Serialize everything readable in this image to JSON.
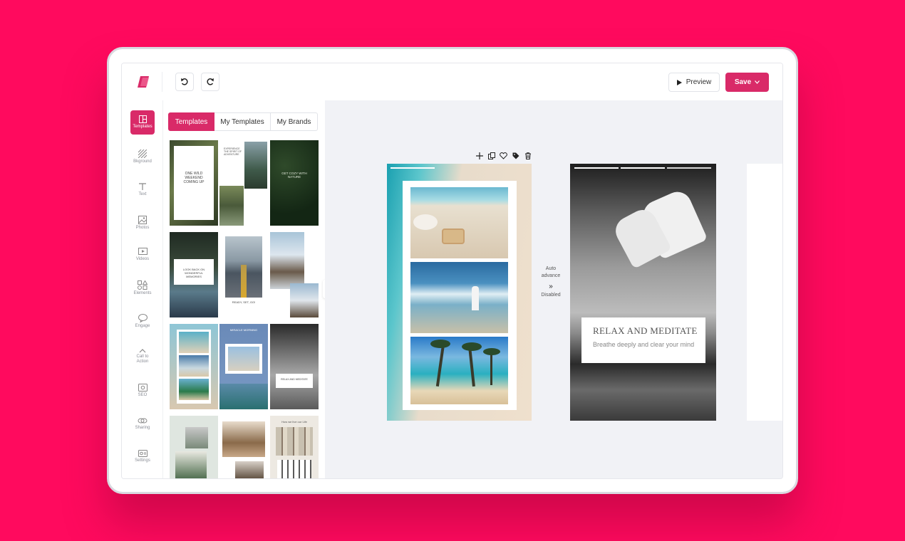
{
  "toolbar": {
    "undo_icon": "undo-icon",
    "redo_icon": "redo-icon",
    "preview_label": "Preview",
    "save_label": "Save"
  },
  "rail": [
    {
      "label": "Templates",
      "icon": "templates-icon",
      "active": true
    },
    {
      "label": "Bkground",
      "icon": "background-icon"
    },
    {
      "label": "Text",
      "icon": "text-icon"
    },
    {
      "label": "Photos",
      "icon": "photo-icon"
    },
    {
      "label": "Videos",
      "icon": "video-icon"
    },
    {
      "label": "Elements",
      "icon": "elements-icon"
    },
    {
      "label": "Engage",
      "icon": "chat-icon"
    },
    {
      "label": "Call to Action",
      "icon": "chevron-up-icon"
    },
    {
      "label": "SEO",
      "icon": "seo-icon"
    },
    {
      "label": "Sharing",
      "icon": "link-icon"
    },
    {
      "label": "Settings",
      "icon": "settings-icon"
    }
  ],
  "tabs": [
    "Templates",
    "My Templates",
    "My Brands"
  ],
  "thumbs": {
    "t1": "ONE WILD WEEKEND COMING UP",
    "t2": "EXPERIENCE THE SPIRIT OF ADVENTURE",
    "t3": "GET COZY WITH NATURE",
    "t4": "LOOK BACK ON WONDERFUL MEMORIES",
    "t5": "READY, SET, GO!",
    "t6": "MIRACLE MORNING",
    "t7": "RELAX AND MEDITATE",
    "t8": "How we live our Life"
  },
  "canvas": {
    "auto_label_1": "Auto",
    "auto_label_2": "advance",
    "auto_state": "Disabled",
    "slide2_title": "RELAX AND MEDITATE",
    "slide2_subtitle": "Breathe deeply and clear your mind"
  },
  "colors": {
    "brand": "#d92a68",
    "background": "#ff0a5e"
  }
}
